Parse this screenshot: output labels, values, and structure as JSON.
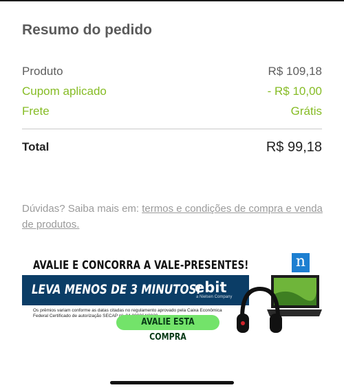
{
  "summary": {
    "title": "Resumo do pedido",
    "rows": [
      {
        "label": "Produto",
        "value": "R$ 109,18"
      },
      {
        "label": "Cupom aplicado",
        "value": "- R$ 10,00"
      },
      {
        "label": "Frete",
        "value": "Grátis"
      }
    ],
    "total_label": "Total",
    "total_value": "R$ 99,18"
  },
  "help": {
    "prefix": "Dúvidas? Saiba mais em:",
    "link": "termos e condições de compra e venda de produtos."
  },
  "banner": {
    "headline": "AVALIE E CONCORRA A VALE-PRESENTES!",
    "badge": "n",
    "bar_text": "LEVA MENOS DE 3 MINUTOS!",
    "logo": "ebit",
    "logo_sub": "a Nielsen Company",
    "fine_print": "Os prêmios variam conforme as datas citadas no regulamento aprovado pela Caixa Econômica Federal Certificado de autorização SECAP nº. 04.000064/2020",
    "button": "AVALIE ESTA COMPRA"
  },
  "colors": {
    "accent_green": "#86bc25",
    "banner_blue": "#0b3d66",
    "cta_green": "#73e36a"
  }
}
